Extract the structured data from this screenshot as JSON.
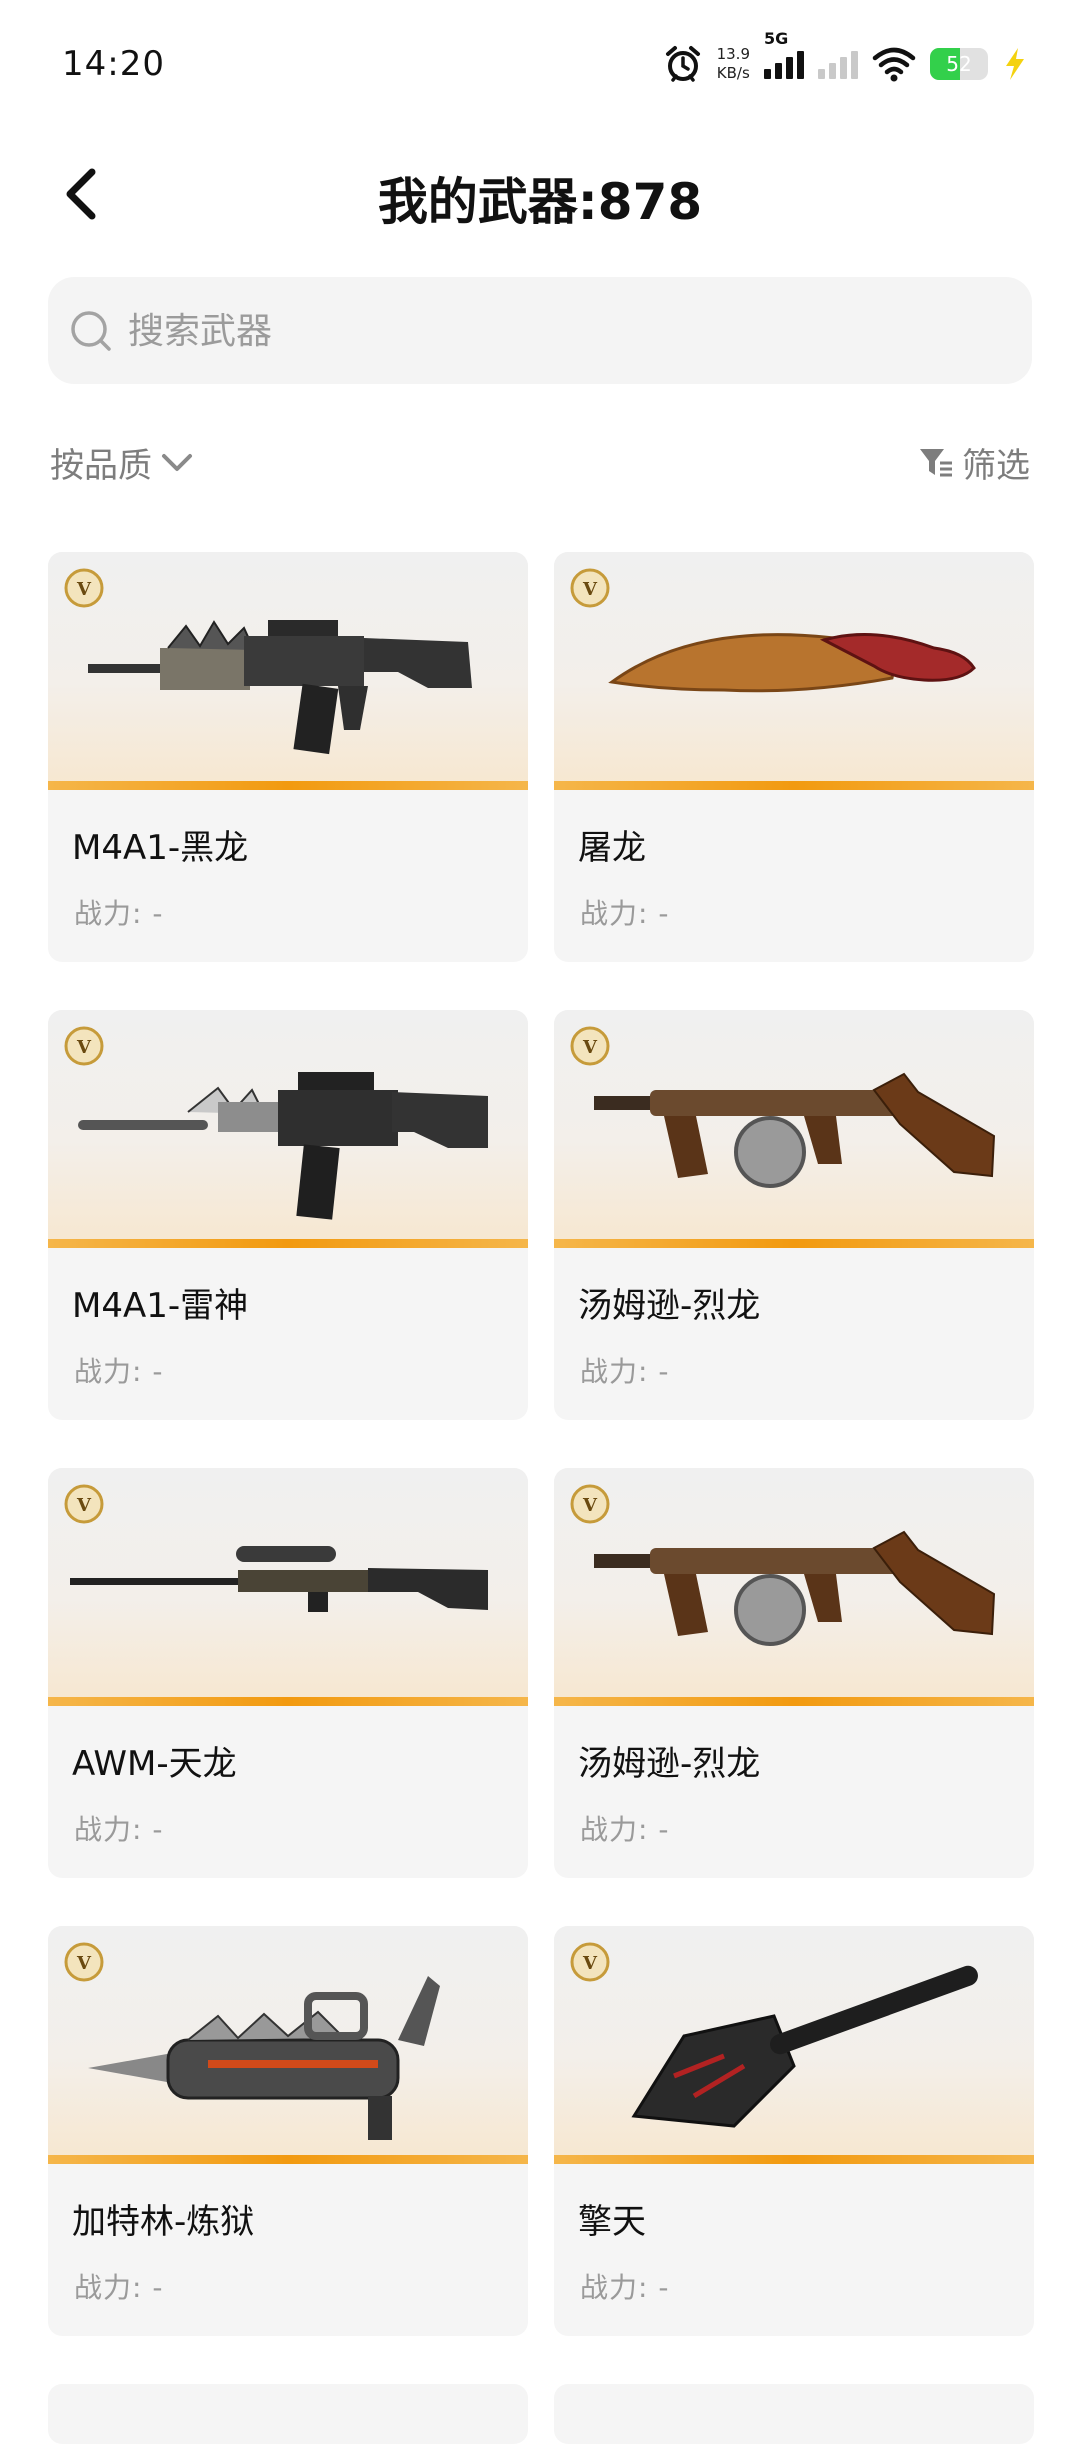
{
  "status_bar": {
    "time": "14:20",
    "net_speed_value": "13.9",
    "net_speed_unit": "KB/s",
    "network_type": "5G",
    "battery": "52",
    "icons": [
      "alarm-icon",
      "signal-icon",
      "wifi-icon",
      "battery-icon",
      "charging-icon"
    ]
  },
  "header": {
    "title": "我的武器:878",
    "back_icon": "chevron-left-icon"
  },
  "search": {
    "placeholder": "搜索武器",
    "value": ""
  },
  "toolbar": {
    "sort_label": "按品质",
    "filter_label": "筛选"
  },
  "weapons": [
    {
      "name": "M4A1-黑龙",
      "power": "战力: -",
      "badge": "V",
      "icon": "rifle-icon"
    },
    {
      "name": "屠龙",
      "power": "战力: -",
      "badge": "V",
      "icon": "knife-icon"
    },
    {
      "name": "M4A1-雷神",
      "power": "战力: -",
      "badge": "V",
      "icon": "rifle-icon"
    },
    {
      "name": "汤姆逊-烈龙",
      "power": "战力: -",
      "badge": "V",
      "icon": "smg-icon"
    },
    {
      "name": "AWM-天龙",
      "power": "战力: -",
      "badge": "V",
      "icon": "sniper-icon"
    },
    {
      "name": "汤姆逊-烈龙",
      "power": "战力: -",
      "badge": "V",
      "icon": "smg-icon"
    },
    {
      "name": "加特林-炼狱",
      "power": "战力: -",
      "badge": "V",
      "icon": "gatling-icon"
    },
    {
      "name": "擎天",
      "power": "战力: -",
      "badge": "V",
      "icon": "shovel-icon"
    }
  ],
  "colors": {
    "accent_bar": "#f29a10",
    "card_bg": "#f5f5f5",
    "search_bg": "#f4f4f4",
    "battery": "#33d04b"
  }
}
